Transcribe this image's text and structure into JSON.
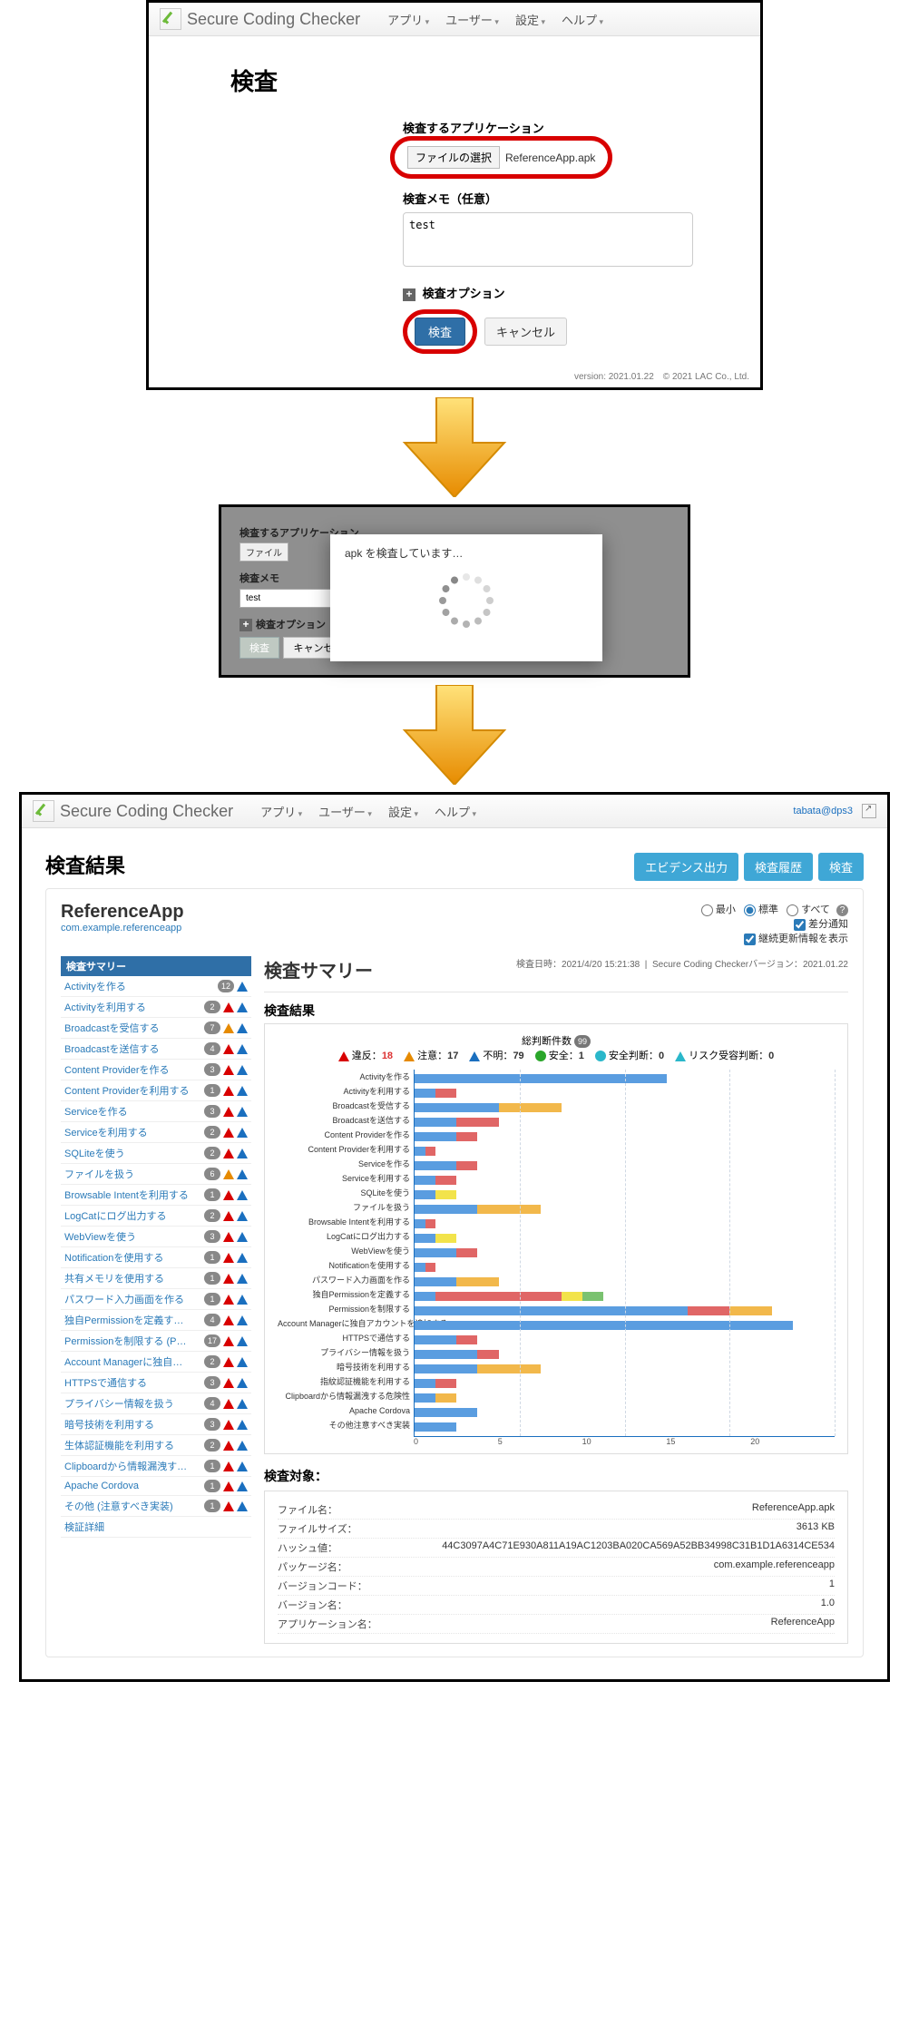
{
  "brand": "Secure Coding Checker",
  "nav": [
    "アプリ",
    "ユーザー",
    "設定",
    "ヘルプ"
  ],
  "user_link": "tabata@dps3",
  "panel1": {
    "title": "検査",
    "label_app": "検査するアプリケーション",
    "file_button": "ファイルの選択",
    "file_name": "ReferenceApp.apk",
    "label_memo": "検査メモ（任意）",
    "memo_value": "test",
    "label_options": "検査オプション",
    "btn_submit": "検査",
    "btn_cancel": "キャンセル",
    "footer": "version: 2021.01.22　© 2021 LAC Co., Ltd."
  },
  "panel2": {
    "label_app": "検査するアプリケーション",
    "file_button": "ファイル",
    "label_memo": "検査メモ",
    "memo_value": "test",
    "label_options": "検査オプション",
    "btn_submit": "検査",
    "btn_cancel": "キャンセル",
    "modal_title": "apk を検査しています…"
  },
  "panel3": {
    "title": "検査結果",
    "btn_evidence": "エビデンス出力",
    "btn_history": "検査履歴",
    "btn_inspect": "検査",
    "app_name": "ReferenceApp",
    "package": "com.example.referenceapp",
    "radios": {
      "min": "最小",
      "std": "標準",
      "all": "すべて"
    },
    "chk_diff": "差分通知",
    "chk_update": "継続更新情報を表示",
    "side_header": "検査サマリー",
    "side_link_detail": "検証詳細",
    "sidebar": [
      {
        "label": "Activityを作る",
        "count": 12,
        "icons": [
          "blue"
        ]
      },
      {
        "label": "Activityを利用する",
        "count": 2,
        "icons": [
          "red",
          "blue"
        ]
      },
      {
        "label": "Broadcastを受信する",
        "count": 7,
        "icons": [
          "orange",
          "blue"
        ]
      },
      {
        "label": "Broadcastを送信する",
        "count": 4,
        "icons": [
          "red",
          "blue"
        ]
      },
      {
        "label": "Content Providerを作る",
        "count": 3,
        "icons": [
          "red",
          "blue"
        ]
      },
      {
        "label": "Content Providerを利用する",
        "count": 1,
        "icons": [
          "red",
          "blue"
        ]
      },
      {
        "label": "Serviceを作る",
        "count": 3,
        "icons": [
          "red",
          "blue"
        ]
      },
      {
        "label": "Serviceを利用する",
        "count": 2,
        "icons": [
          "red",
          "blue"
        ]
      },
      {
        "label": "SQLiteを使う",
        "count": 2,
        "icons": [
          "red",
          "blue"
        ]
      },
      {
        "label": "ファイルを扱う",
        "count": 6,
        "icons": [
          "orange",
          "blue"
        ]
      },
      {
        "label": "Browsable Intentを利用する",
        "count": 1,
        "icons": [
          "red",
          "blue"
        ]
      },
      {
        "label": "LogCatにログ出力する",
        "count": 2,
        "icons": [
          "red",
          "blue"
        ]
      },
      {
        "label": "WebViewを使う",
        "count": 3,
        "icons": [
          "red",
          "blue"
        ]
      },
      {
        "label": "Notificationを使用する",
        "count": 1,
        "icons": [
          "red",
          "blue"
        ]
      },
      {
        "label": "共有メモリを使用する",
        "count": 1,
        "icons": [
          "red",
          "blue"
        ]
      },
      {
        "label": "パスワード入力画面を作る",
        "count": 1,
        "icons": [
          "red",
          "blue"
        ]
      },
      {
        "label": "独自Permissionを定義する (Permissionと Protection Level)",
        "count": 4,
        "icons": [
          "red",
          "blue"
        ]
      },
      {
        "label": "Permissionを制限する (Permissionと Protection Level)",
        "count": 17,
        "icons": [
          "red",
          "blue"
        ]
      },
      {
        "label": "Account Managerに独自アカウントを追加する",
        "count": 2,
        "icons": [
          "red",
          "blue"
        ]
      },
      {
        "label": "HTTPSで通信する",
        "count": 3,
        "icons": [
          "red",
          "blue"
        ]
      },
      {
        "label": "プライバシー情報を扱う",
        "count": 4,
        "icons": [
          "red",
          "blue"
        ]
      },
      {
        "label": "暗号技術を利用する",
        "count": 3,
        "icons": [
          "red",
          "blue"
        ]
      },
      {
        "label": "生体認証機能を利用する",
        "count": 2,
        "icons": [
          "red",
          "blue"
        ]
      },
      {
        "label": "Clipboardから情報漏洩する危険性",
        "count": 1,
        "icons": [
          "red",
          "blue"
        ]
      },
      {
        "label": "Apache Cordova",
        "count": 1,
        "icons": [
          "red",
          "blue"
        ]
      },
      {
        "label": "その他 (注意すべき実装)",
        "count": 1,
        "icons": [
          "red",
          "blue"
        ]
      }
    ],
    "summary": {
      "heading": "検査サマリー",
      "meta_date_label": "検査日時：",
      "meta_date": "2021/4/20 15:21:38",
      "meta_ver_label": "Secure Coding Checkerバージョン：",
      "meta_ver": "2021.01.22",
      "sub_heading": "検査結果",
      "legend_total_label": "総判断件数",
      "legend_total": 99,
      "legend": [
        {
          "icon": "tri red",
          "label": "違反：",
          "value": 18
        },
        {
          "icon": "tri orange",
          "label": "注意：",
          "value": 17
        },
        {
          "icon": "tri blue",
          "label": "不明：",
          "value": 79
        },
        {
          "icon": "circ green",
          "label": "安全：",
          "value": 1
        },
        {
          "icon": "circ cyan",
          "label": "安全判断：",
          "value": 0
        },
        {
          "icon": "tri cyan",
          "label": "リスク受容判断：",
          "value": 0
        }
      ]
    },
    "target": {
      "heading": "検査対象：",
      "rows": [
        {
          "label": "ファイル名：",
          "value": "ReferenceApp.apk"
        },
        {
          "label": "ファイルサイズ：",
          "value": "3613 KB"
        },
        {
          "label": "ハッシュ値：",
          "value": "44C3097A4C71E930A811A19AC1203BA020CA569A52BB34998C31B1D1A6314CE534"
        },
        {
          "label": "パッケージ名：",
          "value": "com.example.referenceapp"
        },
        {
          "label": "バージョンコード：",
          "value": "1"
        },
        {
          "label": "バージョン名：",
          "value": "1.0"
        },
        {
          "label": "アプリケーション名：",
          "value": "ReferenceApp"
        }
      ]
    }
  },
  "chart_data": {
    "type": "bar",
    "orientation": "horizontal",
    "stacked": true,
    "xlabel": "",
    "ylabel": "",
    "xlim": [
      0,
      20
    ],
    "xticks": [
      0,
      5,
      10,
      15,
      20
    ],
    "series_meta": [
      {
        "name": "不明",
        "color": "#5a9de0"
      },
      {
        "name": "違反",
        "color": "#e06666"
      },
      {
        "name": "注意",
        "color": "#f2b84b"
      },
      {
        "name": "その他",
        "color": "#f2e34b"
      },
      {
        "name": "安全",
        "color": "#7ac270"
      }
    ],
    "categories": [
      "Activityを作る",
      "Activityを利用する",
      "Broadcastを受信する",
      "Broadcastを送信する",
      "Content Providerを作る",
      "Content Providerを利用する",
      "Serviceを作る",
      "Serviceを利用する",
      "SQLiteを使う",
      "ファイルを扱う",
      "Browsable Intentを利用する",
      "LogCatにログ出力する",
      "WebViewを使う",
      "Notificationを使用する",
      "パスワード入力画面を作る",
      "独自Permissionを定義する",
      "Permissionを制限する",
      "Account Managerに独自アカウントを追加する",
      "HTTPSで通信する",
      "プライバシー情報を扱う",
      "暗号技術を利用する",
      "指紋認証機能を利用する",
      "Clipboardから情報漏洩する危険性",
      "Apache Cordova",
      "その他注意すべき実装"
    ],
    "values": [
      {
        "blue": 12,
        "red": 0,
        "orange": 0,
        "yellow": 0,
        "green": 0
      },
      {
        "blue": 1,
        "red": 1,
        "orange": 0,
        "yellow": 0,
        "green": 0
      },
      {
        "blue": 4,
        "red": 0,
        "orange": 3,
        "yellow": 0,
        "green": 0
      },
      {
        "blue": 2,
        "red": 2,
        "orange": 0,
        "yellow": 0,
        "green": 0
      },
      {
        "blue": 2,
        "red": 1,
        "orange": 0,
        "yellow": 0,
        "green": 0
      },
      {
        "blue": 0.5,
        "red": 0.5,
        "orange": 0,
        "yellow": 0,
        "green": 0
      },
      {
        "blue": 2,
        "red": 1,
        "orange": 0,
        "yellow": 0,
        "green": 0
      },
      {
        "blue": 1,
        "red": 1,
        "orange": 0,
        "yellow": 0,
        "green": 0
      },
      {
        "blue": 1,
        "red": 0,
        "orange": 0,
        "yellow": 1,
        "green": 0
      },
      {
        "blue": 3,
        "red": 0,
        "orange": 3,
        "yellow": 0,
        "green": 0
      },
      {
        "blue": 0.5,
        "red": 0.5,
        "orange": 0,
        "yellow": 0,
        "green": 0
      },
      {
        "blue": 1,
        "red": 0,
        "orange": 0,
        "yellow": 1,
        "green": 0
      },
      {
        "blue": 2,
        "red": 1,
        "orange": 0,
        "yellow": 0,
        "green": 0
      },
      {
        "blue": 0.5,
        "red": 0.5,
        "orange": 0,
        "yellow": 0,
        "green": 0
      },
      {
        "blue": 2,
        "red": 0,
        "orange": 2,
        "yellow": 0,
        "green": 0
      },
      {
        "blue": 1,
        "red": 6,
        "orange": 0,
        "yellow": 1,
        "green": 1
      },
      {
        "blue": 13,
        "red": 2,
        "orange": 2,
        "yellow": 0,
        "green": 0
      },
      {
        "blue": 18,
        "red": 0,
        "orange": 0,
        "yellow": 0,
        "green": 0
      },
      {
        "blue": 2,
        "red": 1,
        "orange": 0,
        "yellow": 0,
        "green": 0
      },
      {
        "blue": 3,
        "red": 1,
        "orange": 0,
        "yellow": 0,
        "green": 0
      },
      {
        "blue": 3,
        "red": 0,
        "orange": 3,
        "yellow": 0,
        "green": 0
      },
      {
        "blue": 1,
        "red": 1,
        "orange": 0,
        "yellow": 0,
        "green": 0
      },
      {
        "blue": 1,
        "red": 0,
        "orange": 1,
        "yellow": 0,
        "green": 0
      },
      {
        "blue": 3,
        "red": 0,
        "orange": 0,
        "yellow": 0,
        "green": 0
      },
      {
        "blue": 2,
        "red": 0,
        "orange": 0,
        "yellow": 0,
        "green": 0
      }
    ]
  }
}
